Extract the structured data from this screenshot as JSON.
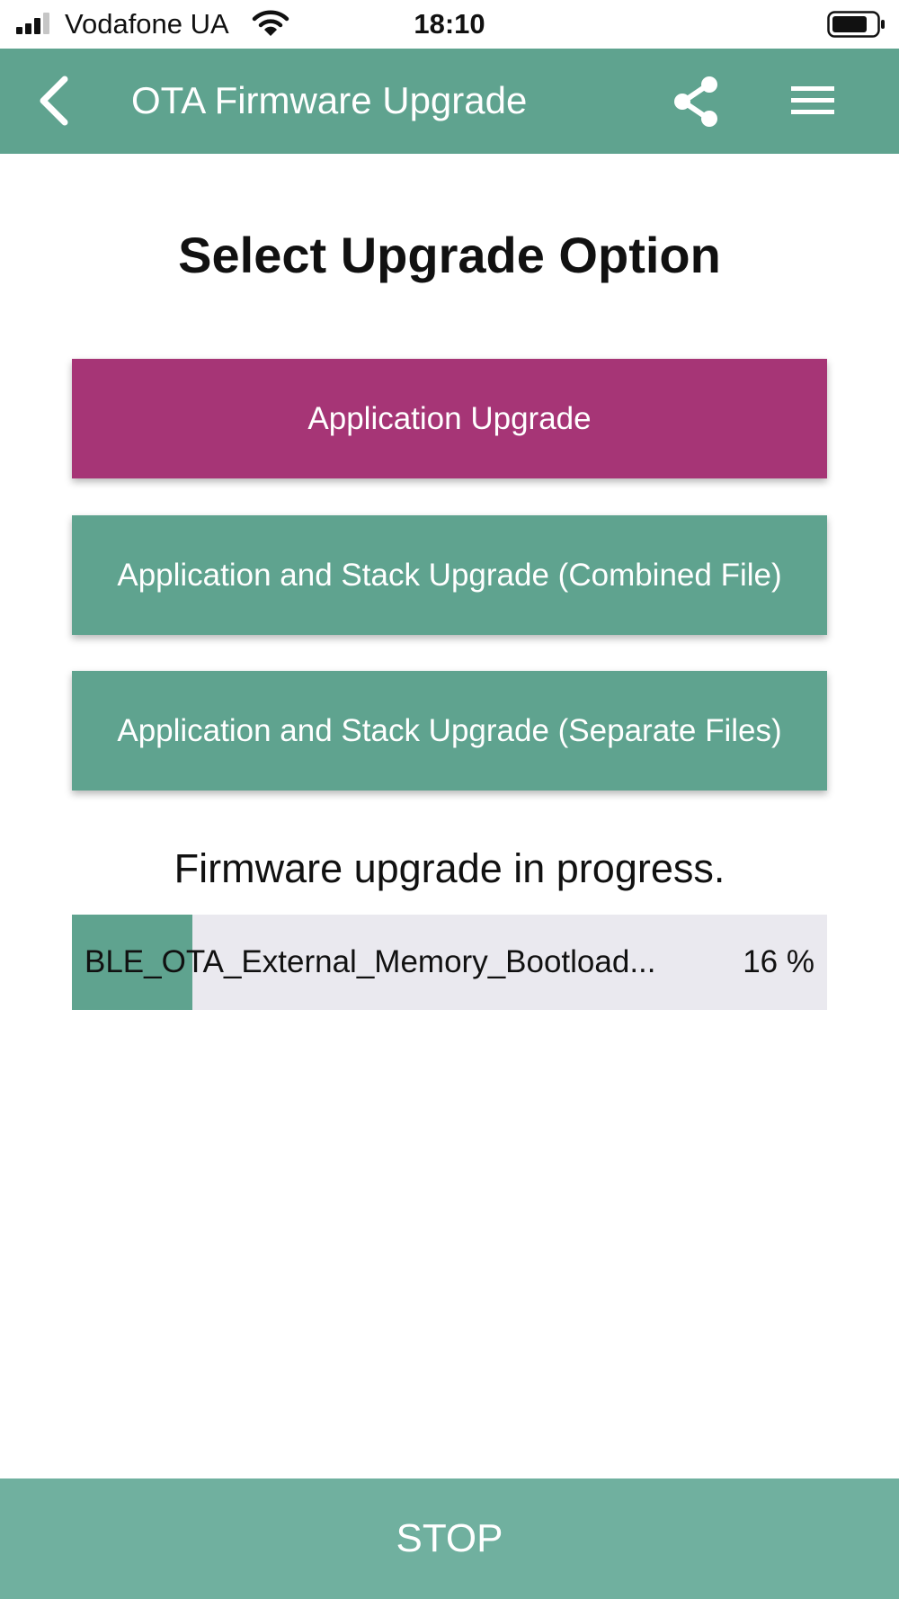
{
  "status_bar": {
    "carrier": "Vodafone UA",
    "time": "18:10",
    "signal_bars_active": 3,
    "icons": [
      "signal-icon",
      "wifi-icon",
      "battery-icon"
    ]
  },
  "app_bar": {
    "title": "OTA Firmware Upgrade",
    "icons": [
      "back-arrow-icon",
      "share-icon",
      "menu-icon"
    ]
  },
  "main": {
    "heading": "Select Upgrade Option",
    "options": [
      {
        "label": "Application Upgrade",
        "selected": true
      },
      {
        "label": "Application and Stack Upgrade (Combined File)",
        "selected": false
      },
      {
        "label": "Application and Stack Upgrade (Separate Files)",
        "selected": false
      }
    ],
    "progress": {
      "status_text": "Firmware upgrade in progress.",
      "file_name": "BLE_OTA_External_Memory_Bootload...",
      "percent_text": "16 %",
      "percent_value": 16
    }
  },
  "footer": {
    "stop_label": "STOP"
  },
  "colors": {
    "primary": "#5fa38f",
    "selected": "#a63576",
    "track": "#eae9ef",
    "stop": "#70b09f"
  }
}
